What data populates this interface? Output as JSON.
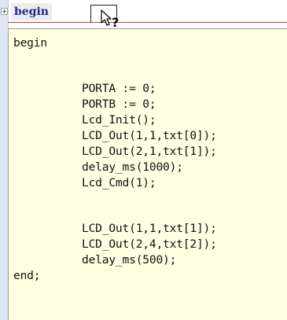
{
  "fold_header": {
    "keyword": "begin",
    "toggle_icon": "plus-expand-icon",
    "cursor_icon": "help-cursor-icon"
  },
  "colors": {
    "keyword": "#1d2c8f",
    "hint_background": "#ffffe1",
    "fold_line": "#d23a3a",
    "gutter": "#dfe6f4"
  },
  "hint": {
    "lines": [
      "begin",
      "PORTA := 0;",
      "PORTB := 0;",
      "Lcd_Init();",
      "LCD_Out(1,1,txt[0]);",
      "LCD_Out(2,1,txt[1]);",
      "delay_ms(1000);",
      "Lcd_Cmd(1);",
      "LCD_Out(1,1,txt[1]);",
      "LCD_Out(2,4,txt[2]);",
      "delay_ms(500);",
      "end;"
    ]
  }
}
